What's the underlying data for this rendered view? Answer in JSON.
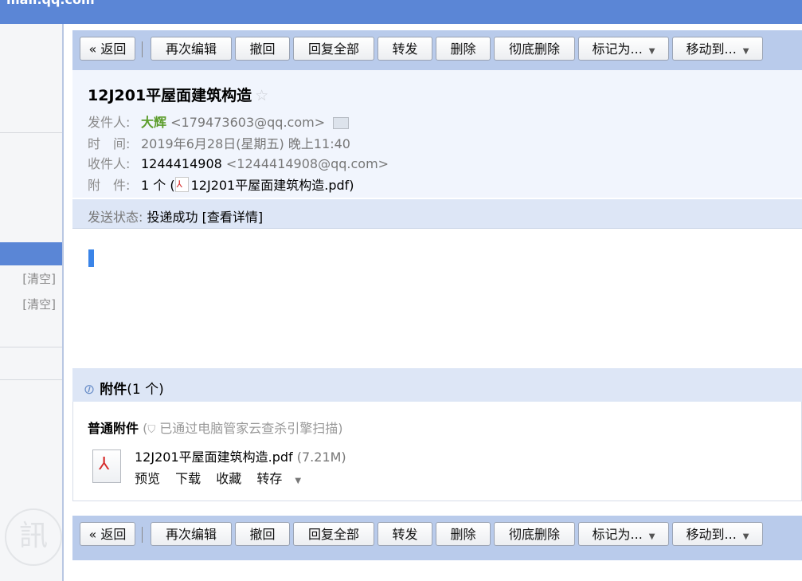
{
  "window": {
    "top_text": "mail.qq.com"
  },
  "sidebar": {
    "clear_1": "[清空]",
    "clear_2": "[清空]",
    "logo_char": "訊"
  },
  "toolbar": {
    "back": "« 返回",
    "edit_again": "再次编辑",
    "recall": "撤回",
    "reply_all": "回复全部",
    "forward": "转发",
    "delete": "删除",
    "delete_permanently": "彻底删除",
    "mark_as": "标记为...",
    "move_to": "移动到..."
  },
  "email": {
    "subject": "12J201平屋面建筑构造",
    "sender_label": "发件人:",
    "sender_name": "大辉",
    "sender_email": "<179473603@qq.com>",
    "time_label": "时　间:",
    "time_value": "2019年6月28日(星期五) 晚上11:40",
    "recipient_label": "收件人:",
    "recipient_name": "1244414908",
    "recipient_email": "<1244414908@qq.com>",
    "attach_label": "附　件:",
    "attach_count": "1 个 (",
    "attach_file": "12J201平屋面建筑构造.pdf",
    "attach_close": ")",
    "status_label": "发送状态:",
    "status_value": "投递成功",
    "status_detail": "[查看详情]"
  },
  "attachments": {
    "title": "附件",
    "count": "(1 个)",
    "normal_label": "普通附件",
    "scan_note": "已通过电脑管家云查杀引擎扫描",
    "file_name": "12J201平屋面建筑构造.pdf",
    "file_size": "(7.21M)",
    "preview": "预览",
    "download": "下载",
    "favorite": "收藏",
    "save_to": "转存"
  },
  "colors": {
    "accent": "#5b86d6",
    "toolbar": "#b9cbeb",
    "header_bg": "#f1f5fd",
    "sender_green": "#5c9d2c"
  }
}
